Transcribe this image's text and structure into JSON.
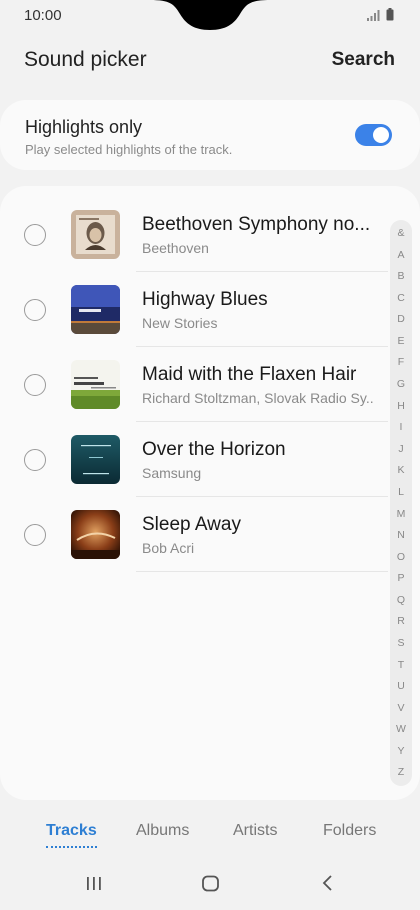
{
  "status": {
    "time": "10:00"
  },
  "header": {
    "title": "Sound picker",
    "search_label": "Search"
  },
  "highlights": {
    "title": "Highlights only",
    "subtitle": "Play selected highlights of the track.",
    "enabled": true
  },
  "tracks": [
    {
      "title": "Beethoven Symphony no...",
      "artist": "Beethoven",
      "selected": false,
      "art": "beethoven-art"
    },
    {
      "title": "Highway Blues",
      "artist": "New Stories",
      "selected": false,
      "art": "highway-art"
    },
    {
      "title": "Maid with the Flaxen Hair",
      "artist": "Richard Stoltzman, Slovak Radio Sy..",
      "selected": false,
      "art": "stoltzman-art"
    },
    {
      "title": "Over the Horizon",
      "artist": "Samsung",
      "selected": false,
      "art": "horizon-art"
    },
    {
      "title": "Sleep Away",
      "artist": "Bob Acri",
      "selected": false,
      "art": "sleep-art"
    }
  ],
  "index_letters": [
    "&",
    "A",
    "B",
    "C",
    "D",
    "E",
    "F",
    "G",
    "H",
    "I",
    "J",
    "K",
    "L",
    "M",
    "N",
    "O",
    "P",
    "Q",
    "R",
    "S",
    "T",
    "U",
    "V",
    "W",
    "Y",
    "Z"
  ],
  "tabs": [
    {
      "label": "Tracks",
      "active": true
    },
    {
      "label": "Albums",
      "active": false
    },
    {
      "label": "Artists",
      "active": false
    },
    {
      "label": "Folders",
      "active": false
    }
  ],
  "colors": {
    "accent": "#2e7fd3",
    "toggle": "#3b82e8"
  }
}
